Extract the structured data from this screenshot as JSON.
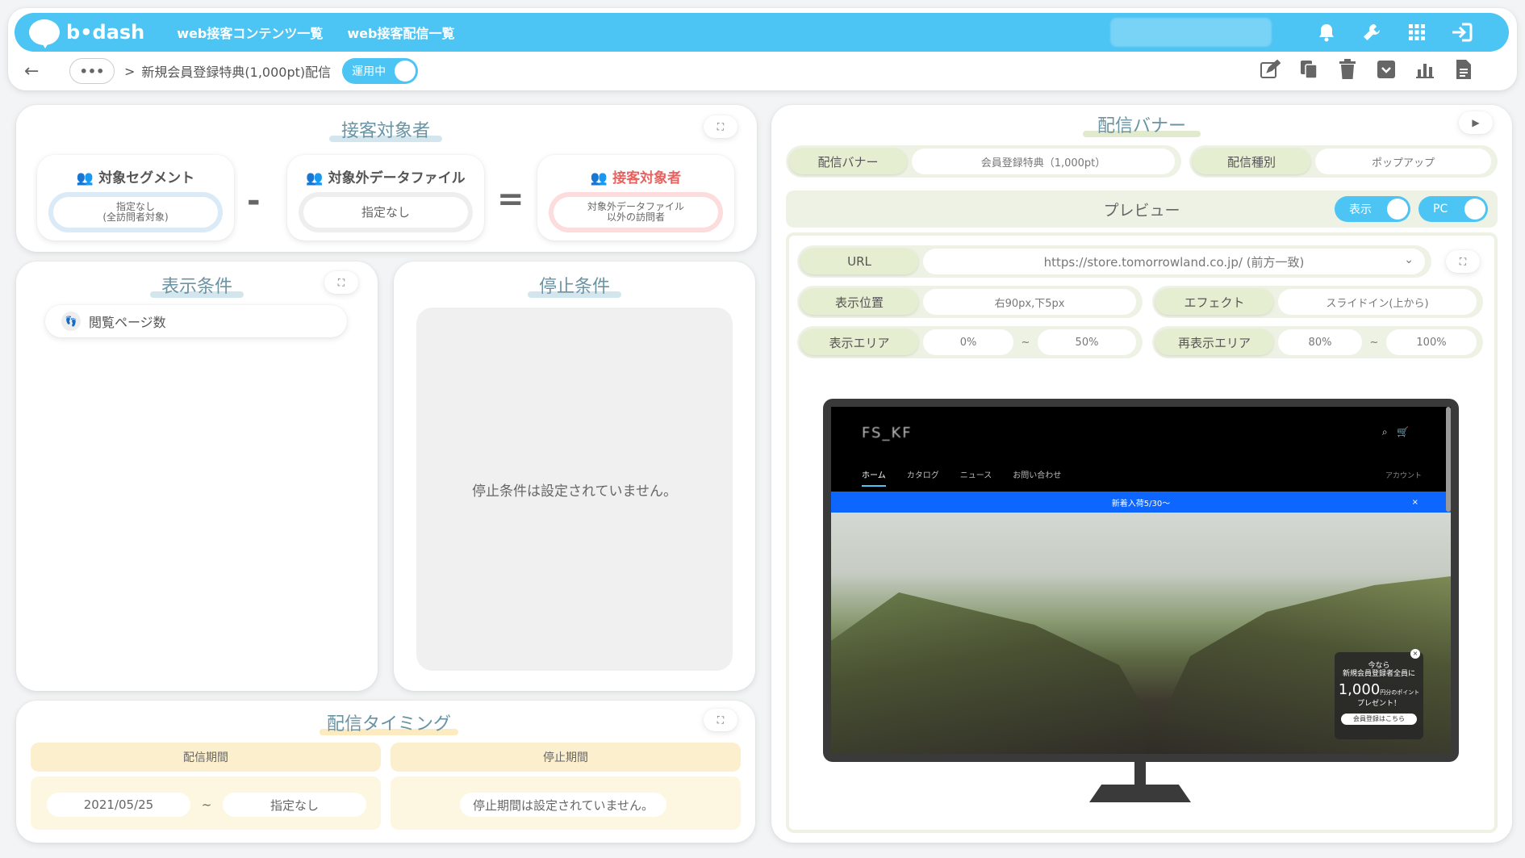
{
  "header": {
    "logo_text": "b•dash",
    "nav": [
      "web接客コンテンツ一覧",
      "web接客配信一覧"
    ],
    "icons": [
      "bell-icon",
      "wrench-icon",
      "grid-icon",
      "logout-icon"
    ]
  },
  "breadcrumb": {
    "back": "←",
    "more": "•••",
    "separator": ">",
    "title": "新規会員登録特典(1,000pt)配信",
    "status_label": "運用中"
  },
  "toolbar_icons": [
    "edit-icon",
    "copy-icon",
    "trash-icon",
    "archive-icon",
    "chart-icon",
    "document-icon"
  ],
  "target": {
    "title": "接客対象者",
    "segment": {
      "label": "対象セグメント",
      "value_line1": "指定なし",
      "value_line2": "(全訪問者対象)"
    },
    "minus": "-",
    "exclude": {
      "label": "対象外データファイル",
      "value": "指定なし"
    },
    "equals": "=",
    "result": {
      "label": "接客対象者",
      "value_line1": "対象外データファイル",
      "value_line2": "以外の訪問者"
    }
  },
  "display_condition": {
    "title": "表示条件",
    "items": [
      "閲覧ページ数"
    ]
  },
  "stop_condition": {
    "title": "停止条件",
    "empty_text": "停止条件は設定されていません。"
  },
  "timing": {
    "title": "配信タイミング",
    "period_label": "配信期間",
    "period_start": "2021/05/25",
    "period_sep": "~",
    "period_end": "指定なし",
    "stop_label": "停止期間",
    "stop_text": "停止期間は設定されていません。"
  },
  "banner": {
    "title": "配信バナー",
    "banner_key": "配信バナー",
    "banner_value": "会員登録特典（1,000pt）",
    "type_key": "配信種別",
    "type_value": "ポップアップ",
    "preview_label": "プレビュー",
    "toggle_show": "表示",
    "toggle_device": "PC",
    "url_key": "URL",
    "url_value": "https://store.tomorrowland.co.jp/ (前方一致)",
    "position_key": "表示位置",
    "position_value": "右90px,下5px",
    "effect_key": "エフェクト",
    "effect_value": "スライドイン(上から)",
    "area_key": "表示エリア",
    "area_from": "0%",
    "area_sep": "~",
    "area_to": "50%",
    "reshow_key": "再表示エリア",
    "reshow_from": "80%",
    "reshow_sep": "~",
    "reshow_to": "100%"
  },
  "site_preview": {
    "logo": "FS_KF",
    "nav": [
      "ホーム",
      "カタログ",
      "ニュース",
      "お問い合わせ"
    ],
    "account": "アカウント",
    "news": "新着入荷5/30〜",
    "news_close": "×",
    "popup_line1": "今なら",
    "popup_line2": "新規会員登録者全員に",
    "popup_big": "1,000",
    "popup_unit": "円分のポイント",
    "popup_line3": "プレゼント！",
    "popup_button": "会員登録はこちら",
    "popup_close": "×"
  }
}
